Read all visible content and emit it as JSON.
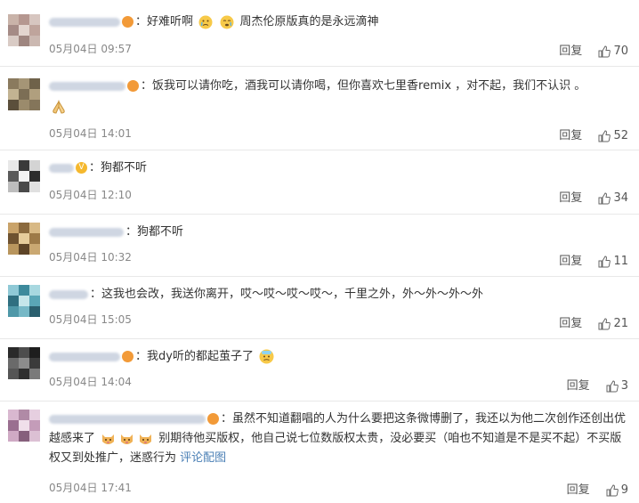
{
  "comments": [
    {
      "text": "好难听啊",
      "text2": "周杰伦原版真的是永远滴神",
      "time": "05月04日 09:57",
      "reply": "回复",
      "likes": "70"
    },
    {
      "text": "饭我可以请你吃，酒我可以请你喝，但你喜欢七里香remix ，对不起，我们不认识 。",
      "time": "05月04日 14:01",
      "reply": "回复",
      "likes": "52"
    },
    {
      "text": "狗都不听",
      "time": "05月04日 12:10",
      "reply": "回复",
      "likes": "34"
    },
    {
      "text": "狗都不听",
      "time": "05月04日 10:32",
      "reply": "回复",
      "likes": "11"
    },
    {
      "text": "这我也会改，我送你离开，哎～哎～哎～哎～，千里之外，外～外～外～外",
      "time": "05月04日 15:05",
      "reply": "回复",
      "likes": "21"
    },
    {
      "text": "我dy听的都起茧子了",
      "time": "05月04日 14:04",
      "reply": "回复",
      "likes": "3"
    },
    {
      "text": "虽然不知道翻唱的人为什么要把这条微博删了，我还以为他二次创作还创出优越感来了",
      "text2": "别期待他买版权，他自己说七位数版权太贵，没必要买（咱也不知道是不是买不起）不买版权又到处推广，迷惑行为",
      "link": "评论配图",
      "time": "05月04日 17:41",
      "reply": "回复",
      "likes": "9"
    }
  ],
  "icons": {
    "thumb": "thumbs-up-icon",
    "badge": "member-badge-icon",
    "emoji": "emoji-icon"
  },
  "colors": {
    "link": "#4a7fb5",
    "meta": "#888888",
    "badge": "#f29a38"
  }
}
